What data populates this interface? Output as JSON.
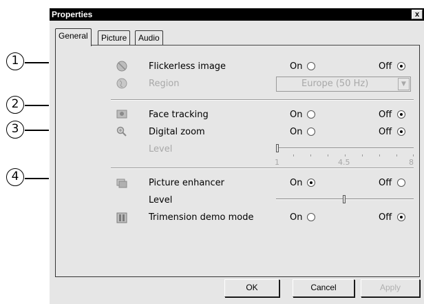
{
  "window": {
    "title": "Properties",
    "close_label": "x"
  },
  "tabs": [
    {
      "label": "General",
      "active": true
    },
    {
      "label": "Picture",
      "active": false
    },
    {
      "label": "Audio",
      "active": false
    }
  ],
  "callouts": [
    "1",
    "2",
    "3",
    "4"
  ],
  "options": {
    "flickerless": {
      "label": "Flickerless image",
      "on": "On",
      "off": "Off",
      "value": "off",
      "icon": "flicker-icon"
    },
    "region": {
      "label": "Region",
      "selected": "Europe (50 Hz)",
      "enabled": false,
      "icon": "globe-icon"
    },
    "face_tracking": {
      "label": "Face tracking",
      "on": "On",
      "off": "Off",
      "value": "off",
      "icon": "face-tracking-icon"
    },
    "digital_zoom": {
      "label": "Digital zoom",
      "on": "On",
      "off": "Off",
      "value": "off",
      "icon": "zoom-icon"
    },
    "zoom_level": {
      "label": "Level",
      "min_label": "1",
      "mid_label": "4.5",
      "max_label": "8",
      "value": 1,
      "enabled": false
    },
    "picture_enhancer": {
      "label": "Picture enhancer",
      "on": "On",
      "off": "Off",
      "value": "on",
      "icon": "enhancer-icon"
    },
    "enhancer_level": {
      "label": "Level",
      "value_fraction": 0.5
    },
    "trimension": {
      "label": "Trimension demo mode",
      "on": "On",
      "off": "Off",
      "value": "off",
      "icon": "trimension-icon"
    }
  },
  "buttons": {
    "ok": "OK",
    "cancel": "Cancel",
    "apply": "Apply"
  }
}
